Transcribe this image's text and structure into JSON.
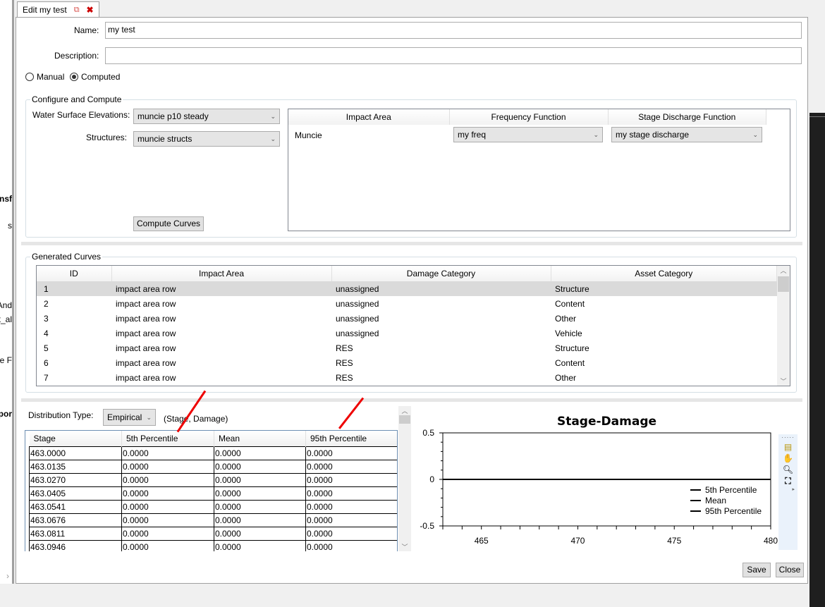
{
  "tab": {
    "title": "Edit my test",
    "popout_icon": "popout-icon",
    "close_icon": "close-icon"
  },
  "left_panel_fragments": [
    "nsf",
    "s",
    "And",
    "t_al",
    "e F",
    "por"
  ],
  "form": {
    "name_label": "Name:",
    "name_value": "my test",
    "description_label": "Description:",
    "description_value": "",
    "mode_options": [
      "Manual",
      "Computed"
    ],
    "mode_selected": "Computed"
  },
  "configure": {
    "title": "Configure and Compute",
    "wse_label": "Water Surface Elevations:",
    "wse_value": "muncie p10 steady",
    "structures_label": "Structures:",
    "structures_value": "muncie structs",
    "compute_button": "Compute Curves",
    "impact_table": {
      "headers": [
        "Impact Area",
        "Frequency Function",
        "Stage Discharge Function"
      ],
      "rows": [
        {
          "impact_area": "Muncie",
          "frequency": "my freq",
          "stage_discharge": "my stage discharge"
        }
      ]
    }
  },
  "generated": {
    "title": "Generated Curves",
    "headers": [
      "ID",
      "Impact Area",
      "Damage Category",
      "Asset Category"
    ],
    "rows": [
      [
        "1",
        "impact area row",
        "unassigned",
        "Structure"
      ],
      [
        "2",
        "impact area row",
        "unassigned",
        "Content"
      ],
      [
        "3",
        "impact area row",
        "unassigned",
        "Other"
      ],
      [
        "4",
        "impact area row",
        "unassigned",
        "Vehicle"
      ],
      [
        "5",
        "impact area row",
        "RES",
        "Structure"
      ],
      [
        "6",
        "impact area row",
        "RES",
        "Content"
      ],
      [
        "7",
        "impact area row",
        "RES",
        "Other"
      ]
    ],
    "selected_row": 0
  },
  "distribution": {
    "label": "Distribution Type:",
    "value": "Empirical",
    "hint": "(Stage, Damage)",
    "headers": [
      "Stage",
      "5th Percentile",
      "Mean",
      "95th Percentile"
    ],
    "rows": [
      [
        "463.0000",
        "0.0000",
        "0.0000",
        "0.0000"
      ],
      [
        "463.0135",
        "0.0000",
        "0.0000",
        "0.0000"
      ],
      [
        "463.0270",
        "0.0000",
        "0.0000",
        "0.0000"
      ],
      [
        "463.0405",
        "0.0000",
        "0.0000",
        "0.0000"
      ],
      [
        "463.0541",
        "0.0000",
        "0.0000",
        "0.0000"
      ],
      [
        "463.0676",
        "0.0000",
        "0.0000",
        "0.0000"
      ],
      [
        "463.0811",
        "0.0000",
        "0.0000",
        "0.0000"
      ],
      [
        "463.0946",
        "0.0000",
        "0.0000",
        "0.0000"
      ]
    ]
  },
  "chart_data": {
    "type": "line",
    "title": "Stage-Damage",
    "xlim": [
      463,
      480
    ],
    "ylim": [
      -0.5,
      0.5
    ],
    "xticks": [
      "465",
      "470",
      "475",
      "480"
    ],
    "yticks": [
      "0.5",
      "0",
      "-0.5"
    ],
    "legend_position": "bottom-right",
    "series": [
      {
        "name": "5th Percentile",
        "x": [
          463,
          480
        ],
        "y": [
          0,
          0
        ],
        "color": "#000000"
      },
      {
        "name": "Mean",
        "x": [
          463,
          480
        ],
        "y": [
          0,
          0
        ],
        "color": "#000000"
      },
      {
        "name": "95th Percentile",
        "x": [
          463,
          480
        ],
        "y": [
          0,
          0
        ],
        "color": "#000000"
      }
    ]
  },
  "chart_toolbar": [
    "annotation-icon",
    "pan-hand-icon",
    "zoom-icon",
    "fit-extents-icon"
  ],
  "buttons": {
    "save": "Save",
    "close": "Close"
  },
  "colors": {
    "annotation_arrow": "#e00000",
    "selected_row": "#dadada"
  }
}
